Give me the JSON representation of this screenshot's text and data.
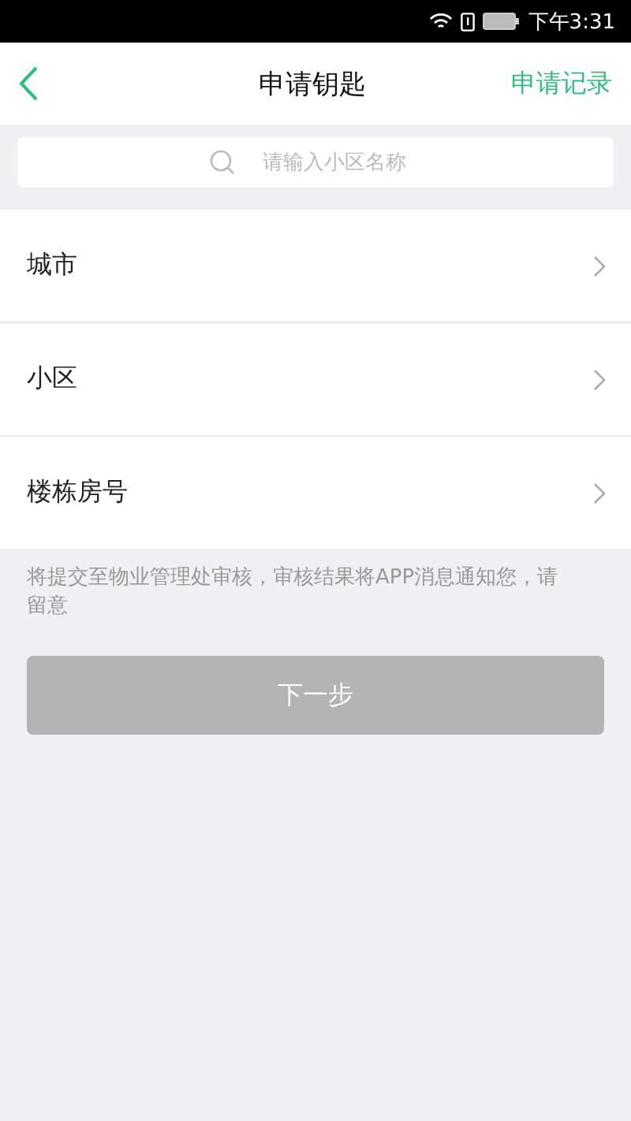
{
  "status_bar": {
    "time": "下午3:31"
  },
  "header": {
    "title": "申请钥匙",
    "action": "申请记录"
  },
  "search": {
    "placeholder": "请输入小区名称"
  },
  "rows": [
    {
      "label": "城市"
    },
    {
      "label": "小区"
    },
    {
      "label": "楼栋房号"
    }
  ],
  "note": "将提交至物业管理处审核，审核结果将APP消息通知您，请留意",
  "next_button": {
    "label": "下一步",
    "disabled": true
  }
}
